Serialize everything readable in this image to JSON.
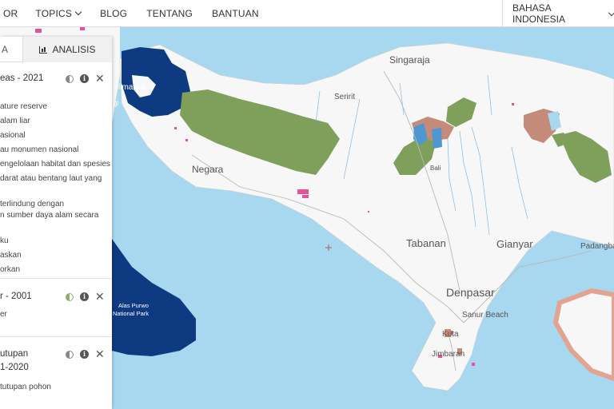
{
  "nav": {
    "items": [
      {
        "label": "OR",
        "chevron": false
      },
      {
        "label": "TOPICS",
        "chevron": true
      },
      {
        "label": "BLOG",
        "chevron": false
      },
      {
        "label": "TENTANG",
        "chevron": false
      },
      {
        "label": "BANTUAN",
        "chevron": false
      }
    ],
    "language": "BAHASA INDONESIA"
  },
  "panel": {
    "tabs": {
      "left": "A",
      "right": "ANALISIS"
    },
    "layers": [
      {
        "title": "eas - 2021",
        "legend": [
          "ature reserve",
          "alam liar",
          "asional",
          "au monumen nasional",
          "engelolaan habitat dan spesies",
          "darat atau bentang laut yang",
          "",
          "terlindung dengan",
          "n sumber daya alam secara",
          "",
          "ku",
          "askan",
          "orkan"
        ]
      },
      {
        "title": "r - 2001",
        "legend": [
          "er"
        ]
      },
      {
        "title": "utupan",
        "subtitle": "1-2020",
        "legend": [
          "tutupan pohon"
        ]
      }
    ]
  },
  "map": {
    "labels": {
      "singaraja": "Singaraja",
      "seririt": "Seririt",
      "gilimanuk": "Gilimanuk",
      "negara": "Negara",
      "tabanan": "Tabanan",
      "gianyar": "Gianyar",
      "padangbai": "Padangba",
      "denpasar": "Denpasar",
      "sanur": "Sanur Beach",
      "kuta": "Kuta",
      "jimbaran": "Jimbaran",
      "bali": "Bali",
      "park": "Alas Purwo\nNational Park",
      "park_line1": "Alas Purwo",
      "park_line2": "National Park",
      "gi": "gi"
    },
    "colors": {
      "sea": "#a7d8f0",
      "land": "#f7f7f7",
      "forest": "#7fa05a",
      "national_park": "#0e3a82",
      "reserve": "#c48a7a",
      "water": "#4f97d1",
      "coastal": "#e2a391",
      "tree_loss": "#e8509c"
    }
  }
}
